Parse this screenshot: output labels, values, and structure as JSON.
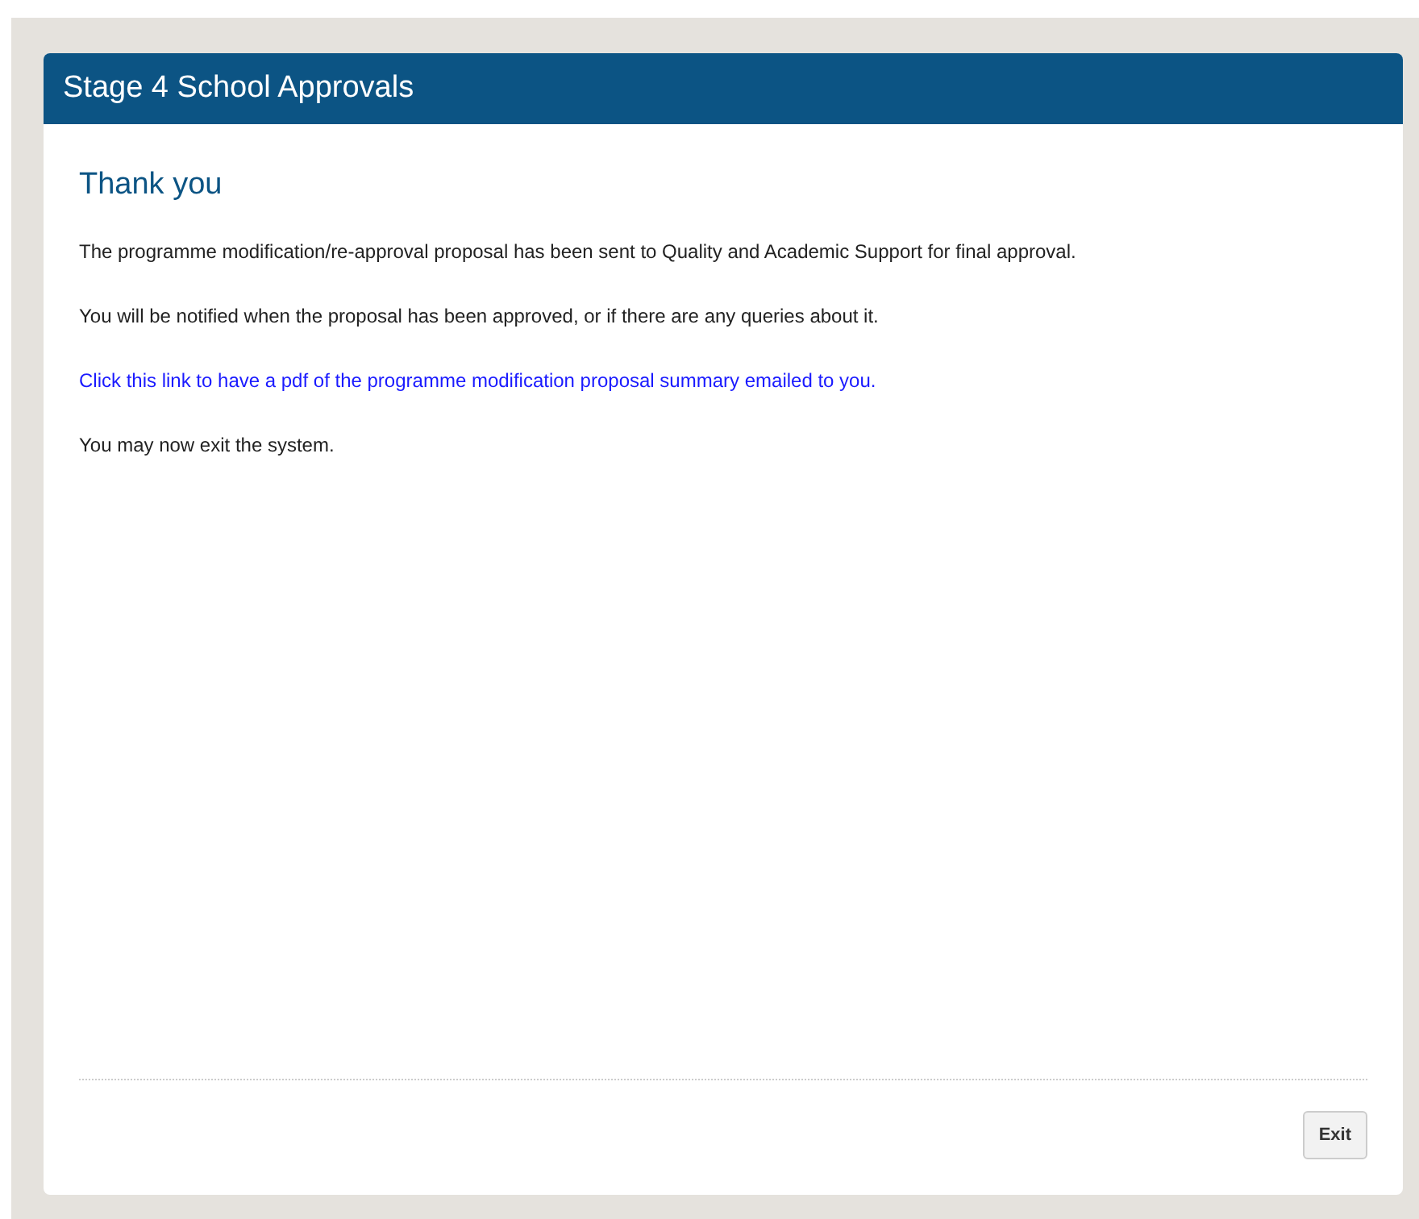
{
  "panel": {
    "title": "Stage 4 School Approvals"
  },
  "heading": "Thank you",
  "paragraphs": [
    {
      "kind": "text",
      "text": "The programme modification/re-approval proposal has been sent to Quality and Academic Support for final approval."
    },
    {
      "kind": "text",
      "text": "You will be notified when the proposal has been approved, or if there are any queries about it."
    },
    {
      "kind": "link",
      "text": "Click this link to have a pdf of the programme modification proposal summary emailed to you."
    },
    {
      "kind": "text",
      "text": "You may now exit the system."
    }
  ],
  "buttons": [
    "Exit"
  ]
}
